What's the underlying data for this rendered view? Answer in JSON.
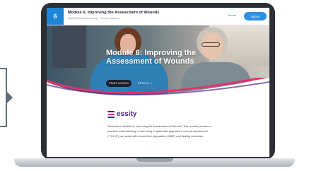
{
  "course": {
    "logo_text": "6",
    "title": "Module 6: Improving the Assessment of Wounds",
    "subtitle": "Essity/BSN Medical Group · Current Version ▾",
    "access_label": "Access",
    "signin_label": "Sign In"
  },
  "hero": {
    "title": "Module 6: Improving the Assessment of Wounds",
    "start_label": "START LESSON",
    "details_label": "DETAILS ⇢"
  },
  "brand": {
    "name": "essity",
    "color": "#4b1b8a"
  },
  "description": "Welcome to Module 6: Improving the Assessment of Wounds. This module provides a practical understanding of how using a systematic approach to wound assessment ('T.I.M.E') can assist with wound bed preparation (WBP) and healing outcomes.",
  "colors": {
    "accent": "#1e86d9",
    "wave_pink": "#e0336f",
    "wave_purple": "#5b2a86"
  }
}
